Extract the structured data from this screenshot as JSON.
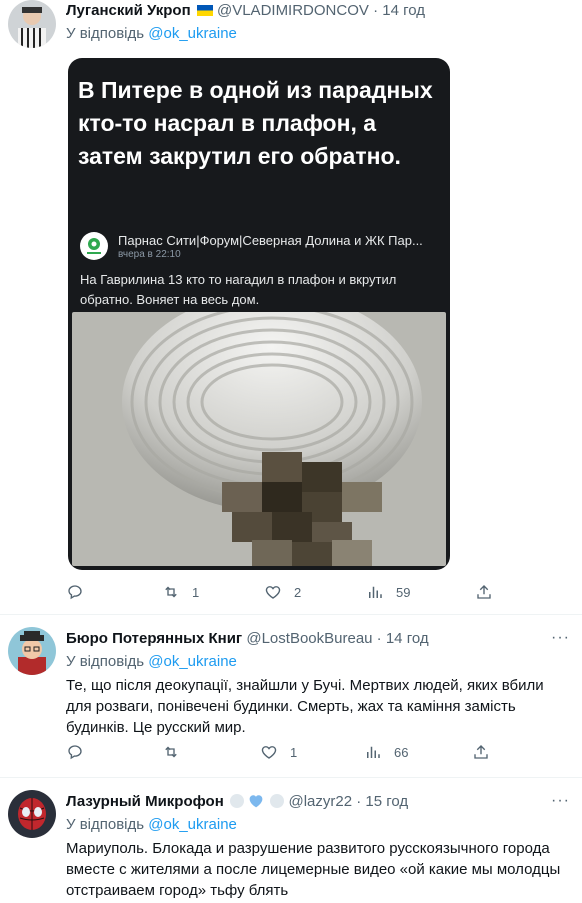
{
  "tweets": [
    {
      "name": "Луганский Укроп",
      "badge": "🇺🇦",
      "handle": "@VLADIMIRDONCOV",
      "sep": "·",
      "time": "14 год",
      "reply_prefix": "У відповідь",
      "reply_to": "@ok_ukraine",
      "card": {
        "headline": "В Питере в одной из парадных кто-то насрал в плафон, а затем закрутил его обратно.",
        "forum_name": "Парнас Сити|Форум|Северная Долина и ЖК Пар...",
        "post_time": "вчера в 22:10",
        "post_text": "На Гаврилина 13 кто то нагадил в плафон и вкрутил обратно. Воняет на весь дом."
      },
      "stats": {
        "replies": "",
        "retweets": "1",
        "likes": "2",
        "views": "59"
      }
    },
    {
      "name": "Бюро Потерянных Книг",
      "handle": "@LostBookBureau",
      "sep": "·",
      "time": "14 год",
      "reply_prefix": "У відповідь",
      "reply_to": "@ok_ukraine",
      "text": "Те, що після деокупації, знайшли у Бучі. Мертвих людей, яких вбили для розваги, понівечені будинки. Смерть, жах та каміння замість будинків. Це русский мир.",
      "stats": {
        "replies": "",
        "retweets": "",
        "likes": "1",
        "views": "66"
      }
    },
    {
      "name": "Лазурный Микрофон",
      "handle": "@lazyr22",
      "sep": "·",
      "time": "15 год",
      "reply_prefix": "У відповідь",
      "reply_to": "@ok_ukraine",
      "text": "Мариуполь. Блокада и разрушение развитого русскоязычного города вместе с жителями а после лицемерные видео «ой какие мы молодцы отстраиваем город» тьфу блять"
    }
  ],
  "more_label": "···",
  "icons": [
    "reply-icon",
    "retweet-icon",
    "like-icon",
    "views-icon",
    "share-icon"
  ]
}
